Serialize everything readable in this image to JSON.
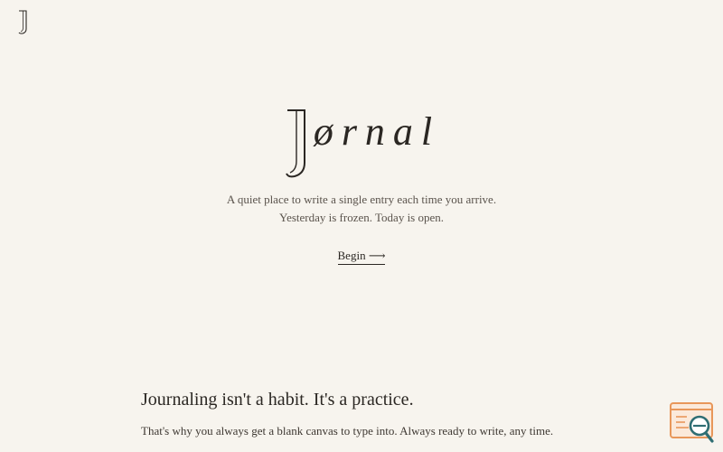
{
  "brand": {
    "wordmark": "ørnal",
    "logo_icon": "journal-j-logo-icon"
  },
  "hero": {
    "tagline_line1": "A quiet place to write a single entry each time you arrive.",
    "tagline_line2": "Yesterday is frozen. Today is open.",
    "cta_label": "Begin ⟶"
  },
  "intro": {
    "heading": "Journaling isn't a habit. It's a practice.",
    "body": "That's why you always get a blank canvas to type into. Always ready to write, any time."
  },
  "widget": {
    "icon": "search-window-icon",
    "accent": "#e8975a",
    "lens_color": "#2f6e73"
  },
  "colors": {
    "background": "#f7f4ee",
    "ink": "#2b2723"
  }
}
